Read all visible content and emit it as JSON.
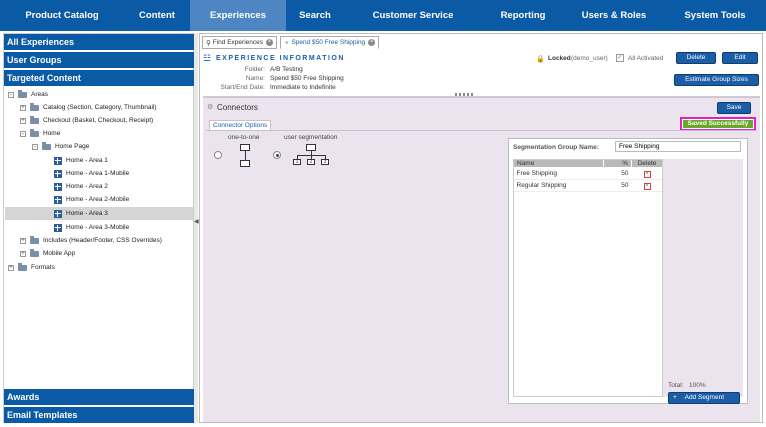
{
  "nav": {
    "items": [
      {
        "label": "Product Catalog"
      },
      {
        "label": "Content"
      },
      {
        "label": "Experiences"
      },
      {
        "label": "Search"
      },
      {
        "label": "Customer Service"
      },
      {
        "label": "Reporting"
      },
      {
        "label": "Users & Roles"
      },
      {
        "label": "System Tools"
      }
    ],
    "active": "Experiences"
  },
  "sidebar": {
    "all_experiences": "All Experiences",
    "user_groups": "User Groups",
    "targeted_content": "Targeted Content",
    "awards": "Awards",
    "email_templates": "Email Templates",
    "tree": [
      {
        "label": "Areas",
        "toggle": "-",
        "type": "folder"
      },
      {
        "label": "Catalog (Section, Category, Thumbnail)",
        "toggle": "+",
        "type": "folder"
      },
      {
        "label": "Checkout (Basket, Checkout, Receipt)",
        "toggle": "+",
        "type": "folder"
      },
      {
        "label": "Home",
        "toggle": "-",
        "type": "folder"
      },
      {
        "label": "Home Page",
        "toggle": "-",
        "type": "folder"
      },
      {
        "label": "Home - Area 1",
        "toggle": "",
        "type": "area"
      },
      {
        "label": "Home - Area 1-Mobile",
        "toggle": "",
        "type": "area"
      },
      {
        "label": "Home - Area 2",
        "toggle": "",
        "type": "area"
      },
      {
        "label": "Home - Area 2-Mobile",
        "toggle": "",
        "type": "area"
      },
      {
        "label": "Home - Area 3",
        "toggle": "",
        "type": "area",
        "selected": true
      },
      {
        "label": "Home - Area 3-Mobile",
        "toggle": "",
        "type": "area"
      },
      {
        "label": "Includes (Header/Footer, CSS Overrides)",
        "toggle": "+",
        "type": "folder"
      },
      {
        "label": "Mobile App",
        "toggle": "+",
        "type": "folder"
      },
      {
        "label": "Formats",
        "toggle": "+",
        "type": "folder"
      }
    ]
  },
  "tabs": [
    {
      "label": "Find Experiences"
    },
    {
      "label": "Spend $50 Free Shipping"
    }
  ],
  "experience": {
    "header": "EXPERIENCE INFORMATION",
    "folder_label": "Folder:",
    "folder_value": "A/B Testing",
    "name_label": "Name:",
    "name_value": "Spend $50 Free Shipping",
    "dates_label": "Start/End Date:",
    "dates_value": "Immediate to Indefinite",
    "locked_text": "Locked",
    "locked_user": "(demo_user)",
    "activated_text": "All Activated",
    "delete_label": "Delete",
    "edit_label": "Edit",
    "estimate_label": "Estimate Group Sizes"
  },
  "connectors": {
    "title": "Connectors",
    "save_label": "Save",
    "saved_message": "Saved Successfully",
    "options_label": "Connector Options",
    "one_to_one_label": "one-to-one",
    "user_segmentation_label": "user segmentation",
    "selected": "user segmentation",
    "node_labels": [
      "1",
      "2",
      "3"
    ]
  },
  "segmentation": {
    "group_name_label": "Segmentation Group Name:",
    "group_name_value": "Free Shipping",
    "columns": [
      "Name",
      "%",
      "Delete"
    ],
    "rows": [
      {
        "name": "Free Shipping",
        "pct": "50"
      },
      {
        "name": "Regular Shipping",
        "pct": "50"
      }
    ],
    "delete_glyph": "×",
    "total_label": "Total:",
    "total_value": "100%",
    "add_segment_label": "Add Segment"
  },
  "colors": {
    "nav_bg": "#0b5aa6",
    "nav_active": "#4d86c2",
    "accent": "#1b5ea8",
    "saved_green": "#6aa829",
    "saved_border": "#e020c0",
    "panel_bg": "#ebe4ef"
  }
}
